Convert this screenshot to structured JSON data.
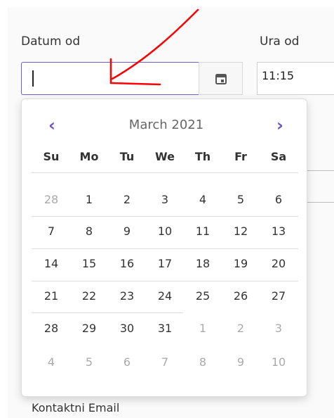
{
  "form": {
    "date_label": "Datum od",
    "time_label": "Ura od",
    "date_value": "",
    "time_value": "11:15",
    "contact_label": "Kontaktni Email"
  },
  "calendar": {
    "month_title": "March 2021",
    "weekdays": [
      "Su",
      "Mo",
      "Tu",
      "We",
      "Th",
      "Fr",
      "Sa"
    ],
    "weeks": [
      [
        {
          "day": "28",
          "other_month": true
        },
        {
          "day": "1",
          "other_month": false
        },
        {
          "day": "2",
          "other_month": false
        },
        {
          "day": "3",
          "other_month": false
        },
        {
          "day": "4",
          "other_month": false
        },
        {
          "day": "5",
          "other_month": false
        },
        {
          "day": "6",
          "other_month": false
        }
      ],
      [
        {
          "day": "7",
          "other_month": false
        },
        {
          "day": "8",
          "other_month": false
        },
        {
          "day": "9",
          "other_month": false
        },
        {
          "day": "10",
          "other_month": false
        },
        {
          "day": "11",
          "other_month": false
        },
        {
          "day": "12",
          "other_month": false
        },
        {
          "day": "13",
          "other_month": false
        }
      ],
      [
        {
          "day": "14",
          "other_month": false
        },
        {
          "day": "15",
          "other_month": false
        },
        {
          "day": "16",
          "other_month": false
        },
        {
          "day": "17",
          "other_month": false
        },
        {
          "day": "18",
          "other_month": false
        },
        {
          "day": "19",
          "other_month": false
        },
        {
          "day": "20",
          "other_month": false
        }
      ],
      [
        {
          "day": "21",
          "other_month": false
        },
        {
          "day": "22",
          "other_month": false
        },
        {
          "day": "23",
          "other_month": false
        },
        {
          "day": "24",
          "other_month": false
        },
        {
          "day": "25",
          "other_month": false
        },
        {
          "day": "26",
          "other_month": false
        },
        {
          "day": "27",
          "other_month": false
        }
      ],
      [
        {
          "day": "28",
          "other_month": false
        },
        {
          "day": "29",
          "other_month": false
        },
        {
          "day": "30",
          "other_month": false
        },
        {
          "day": "31",
          "other_month": false
        },
        {
          "day": "1",
          "other_month": true
        },
        {
          "day": "2",
          "other_month": true
        },
        {
          "day": "3",
          "other_month": true
        }
      ],
      [
        {
          "day": "4",
          "other_month": true
        },
        {
          "day": "5",
          "other_month": true
        },
        {
          "day": "6",
          "other_month": true
        },
        {
          "day": "7",
          "other_month": true
        },
        {
          "day": "8",
          "other_month": true
        },
        {
          "day": "9",
          "other_month": true
        },
        {
          "day": "10",
          "other_month": true
        }
      ]
    ]
  },
  "icons": {
    "calendar_button": "calendar-icon",
    "prev": "chevron-left-icon",
    "next": "chevron-right-icon"
  },
  "colors": {
    "accent": "#6d55c7",
    "annotation": "#ff0000",
    "muted_day": "#aaaaaa"
  }
}
